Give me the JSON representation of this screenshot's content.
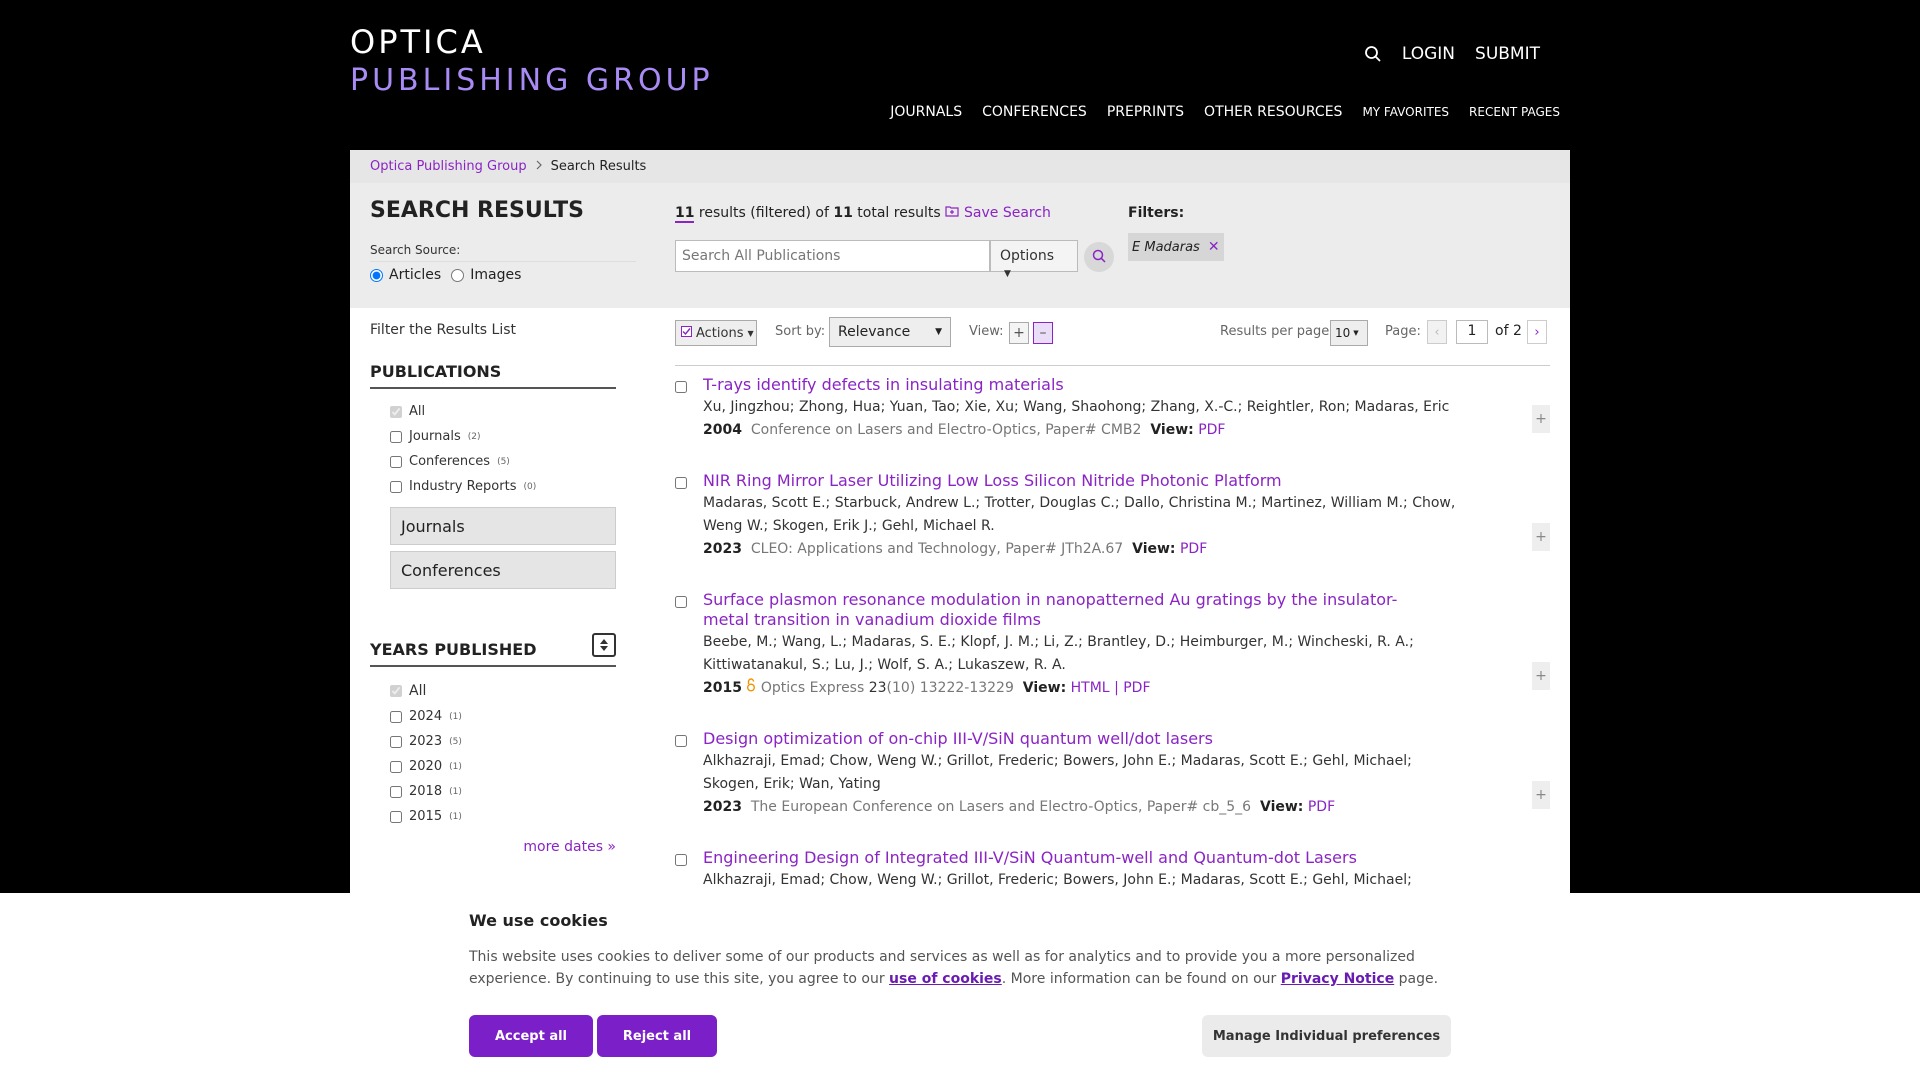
{
  "header": {
    "logo_top": "OPTICA",
    "logo_bottom": "PUBLISHING GROUP",
    "login": "LOGIN",
    "submit": "SUBMIT",
    "nav": [
      "JOURNALS",
      "CONFERENCES",
      "PREPRINTS",
      "OTHER RESOURCES",
      "MY FAVORITES",
      "RECENT PAGES"
    ]
  },
  "breadcrumb": {
    "home": "Optica Publishing Group",
    "current": "Search Results"
  },
  "search": {
    "title": "SEARCH RESULTS",
    "source_label": "Search Source:",
    "source_articles": "Articles",
    "source_images": "Images",
    "count_filtered": "11",
    "count_text_1": " results (filtered) of ",
    "count_total": "11",
    "count_text_2": " total results",
    "save_search": "Save Search",
    "placeholder": "Search All Publications",
    "options": "Options",
    "filters_label": "Filters:",
    "filter_chip": "E Madaras"
  },
  "left": {
    "filter_title": "Filter the Results List",
    "publications_title": "PUBLICATIONS",
    "publications": [
      {
        "label": "All",
        "count": ""
      },
      {
        "label": "Journals",
        "count": "(2)"
      },
      {
        "label": "Conferences",
        "count": "(5)"
      },
      {
        "label": "Industry Reports",
        "count": "(0)"
      }
    ],
    "box_journals": "Journals",
    "box_conferences": "Conferences",
    "years_title": "YEARS PUBLISHED",
    "years": [
      {
        "label": "All",
        "count": ""
      },
      {
        "label": "2024",
        "count": "(1)"
      },
      {
        "label": "2023",
        "count": "(5)"
      },
      {
        "label": "2020",
        "count": "(1)"
      },
      {
        "label": "2018",
        "count": "(1)"
      },
      {
        "label": "2015",
        "count": "(1)"
      }
    ],
    "more_dates": "more dates »"
  },
  "toolbar": {
    "actions": "Actions",
    "sort_label": "Sort by:",
    "sort_value": "Relevance",
    "view_label": "View:",
    "rpp_label": "Results per page:",
    "rpp_value": "10",
    "page_label": "Page:",
    "page_value": "1",
    "page_of": "of 2"
  },
  "results": [
    {
      "title": "T-rays identify defects in insulating materials",
      "authors": "Xu, Jingzhou; Zhong, Hua; Yuan, Tao; Xie, Xu; Wang, Shaohong; Zhang, X.-C.; Reightler, Ron; Madaras, Eric",
      "year": "2004",
      "source": "Conference on Lasers and Electro-Optics, Paper# CMB2",
      "view_label": "View:",
      "links": [
        "PDF"
      ]
    },
    {
      "title": "NIR Ring Mirror Laser Utilizing Low Loss Silicon Nitride Photonic Platform",
      "authors": "Madaras, Scott E.; Starbuck, Andrew L.; Trotter, Douglas C.; Dallo, Christina M.; Martinez, William M.; Chow, Weng W.; Skogen, Erik J.; Gehl, Michael R.",
      "year": "2023",
      "source": "CLEO: Applications and Technology, Paper# JTh2A.67",
      "view_label": "View:",
      "links": [
        "PDF"
      ]
    },
    {
      "title": "Surface plasmon resonance modulation in nanopatterned Au gratings by the insulator-metal transition in vanadium dioxide films",
      "authors": "Beebe, M.; Wang, L.; Madaras, S. E.; Klopf, J. M.; Li, Z.; Brantley, D.; Heimburger, M.; Wincheski, R. A.; Kittiwatanakul, S.; Lu, J.; Wolf, S. A.; Lukaszew, R. A.",
      "year": "2015",
      "source_journal": "Optics Express ",
      "source_vol": "23",
      "source_rest": "(10) 13222-13229",
      "view_label": "View:",
      "links": [
        "HTML",
        "PDF"
      ]
    },
    {
      "title": "Design optimization of on-chip III-V/SiN quantum well/dot lasers",
      "authors": "Alkhazraji, Emad; Chow, Weng W.; Grillot, Frederic; Bowers, John E.; Madaras, Scott E.; Gehl, Michael; Skogen, Erik; Wan, Yating",
      "year": "2023",
      "source": "The European Conference on Lasers and Electro-Optics, Paper# cb_5_6",
      "view_label": "View:",
      "links": [
        "PDF"
      ]
    },
    {
      "title": "Engineering Design of Integrated III-V/SiN Quantum-well and Quantum-dot Lasers",
      "authors": "Alkhazraji, Emad; Chow, Weng W.; Grillot, Frederic; Bowers, John E.; Madaras, Scott E.; Gehl, Michael; Skogen, Erik;"
    }
  ],
  "cookie": {
    "title": "We use cookies",
    "text_1": "This website uses cookies to deliver some of our products and services as well as for analytics and to provide you a more personalized experience. By continuing to use this site, you agree to our ",
    "link_cookies": "use of cookies",
    "text_2": ". More information can be found on our ",
    "link_privacy": "Privacy Notice",
    "text_3": " page.",
    "accept": "Accept all",
    "reject": "Reject all",
    "manage": "Manage Individual preferences"
  },
  "colors": {
    "accent": "#8a24c4",
    "button": "#7b1fc9",
    "logo_bottom": "#a98bf5"
  }
}
